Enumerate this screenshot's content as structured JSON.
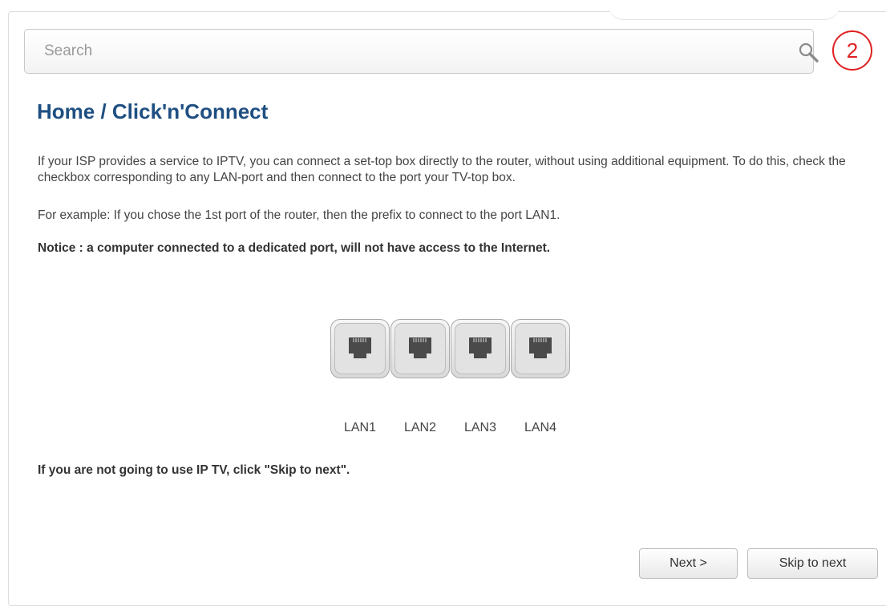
{
  "search": {
    "placeholder": "Search"
  },
  "step": {
    "number": "2",
    "color": "#e02020"
  },
  "header": {
    "title": "Home /  Click'n'Connect"
  },
  "content": {
    "paragraph1": "If your ISP provides a service to IPTV, you can connect a set-top box directly to the router, without using additional equipment. To do this, check the checkbox corresponding to any LAN-port and then connect to the port your TV-top box.",
    "paragraph2": "For example: If you chose the 1st port of the router, then the prefix to connect to the port LAN1.",
    "notice": "Notice : a computer connected to a dedicated port, will not have access to the Internet.",
    "skip_hint": "If you are not going to use IP TV, click \"Skip to next\"."
  },
  "ports": [
    {
      "label": "LAN1",
      "icon": "ethernet-port-icon"
    },
    {
      "label": "LAN2",
      "icon": "ethernet-port-icon"
    },
    {
      "label": "LAN3",
      "icon": "ethernet-port-icon"
    },
    {
      "label": "LAN4",
      "icon": "ethernet-port-icon"
    }
  ],
  "buttons": {
    "next": "Next >",
    "skip": "Skip to next"
  },
  "colors": {
    "title": "#1f4f82",
    "accent": "#e02020"
  }
}
